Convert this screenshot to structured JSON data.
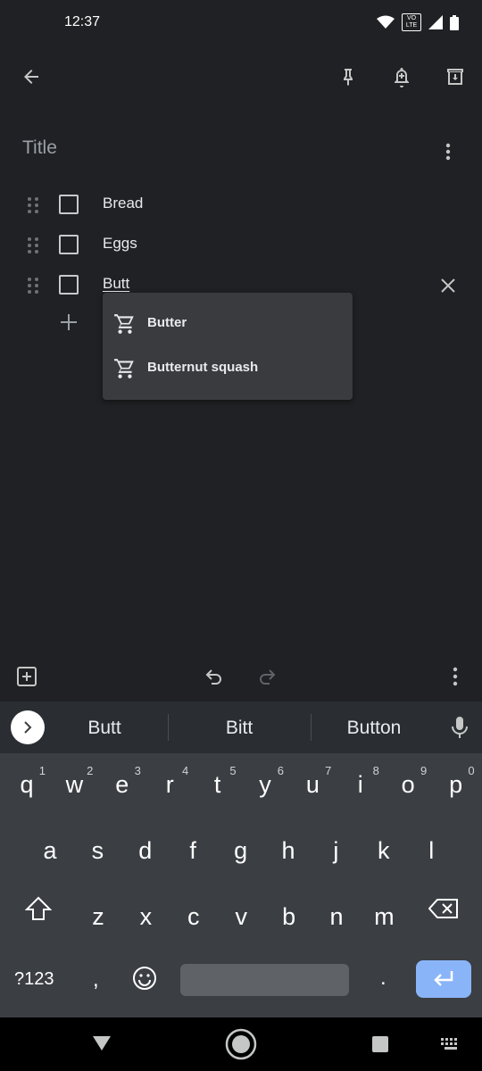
{
  "status_bar": {
    "time": "12:37",
    "volte_label": "VO LTE"
  },
  "note": {
    "title_placeholder": "Title",
    "items": [
      {
        "text": "Bread",
        "checked": false
      },
      {
        "text": "Eggs",
        "checked": false
      },
      {
        "text": "Butt",
        "checked": false,
        "editing": true
      }
    ]
  },
  "suggestions_popup": {
    "items": [
      "Butter",
      "Butternut squash"
    ]
  },
  "keyboard": {
    "suggestions": [
      "Butt",
      "Bitt",
      "Button"
    ],
    "row1": [
      {
        "ch": "q",
        "num": "1"
      },
      {
        "ch": "w",
        "num": "2"
      },
      {
        "ch": "e",
        "num": "3"
      },
      {
        "ch": "r",
        "num": "4"
      },
      {
        "ch": "t",
        "num": "5"
      },
      {
        "ch": "y",
        "num": "6"
      },
      {
        "ch": "u",
        "num": "7"
      },
      {
        "ch": "i",
        "num": "8"
      },
      {
        "ch": "o",
        "num": "9"
      },
      {
        "ch": "p",
        "num": "0"
      }
    ],
    "row2": [
      "a",
      "s",
      "d",
      "f",
      "g",
      "h",
      "j",
      "k",
      "l"
    ],
    "row3": [
      "z",
      "x",
      "c",
      "v",
      "b",
      "n",
      "m"
    ],
    "symbols_label": "?123",
    "comma": ",",
    "period": "."
  },
  "colors": {
    "background": "#202124",
    "enter_key": "#8ab4f8",
    "keyboard_bg": "#3b3e43"
  }
}
